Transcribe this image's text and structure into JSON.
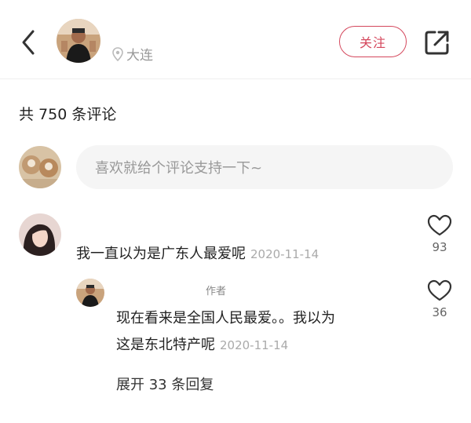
{
  "header": {
    "location": "大连",
    "follow_label": "关注"
  },
  "comments_header": {
    "count_text": "共 750 条评论"
  },
  "input": {
    "placeholder": "喜欢就给个评论支持一下~"
  },
  "comments": [
    {
      "text": "我一直以为是广东人最爱呢",
      "date": "2020-11-14",
      "likes": "93"
    }
  ],
  "reply": {
    "author_tag": "作者",
    "line1": "现在看来是全国人民最爱。。我以为",
    "line2": "这是东北特产呢",
    "date": "2020-11-14",
    "likes": "36",
    "expand_label": "展开 33 条回复"
  },
  "colors": {
    "accent": "#d4475c",
    "muted": "#aaaaaa",
    "input_bg": "#f5f5f5"
  },
  "icons": [
    "back-icon",
    "location-pin-icon",
    "share-icon",
    "heart-icon"
  ]
}
